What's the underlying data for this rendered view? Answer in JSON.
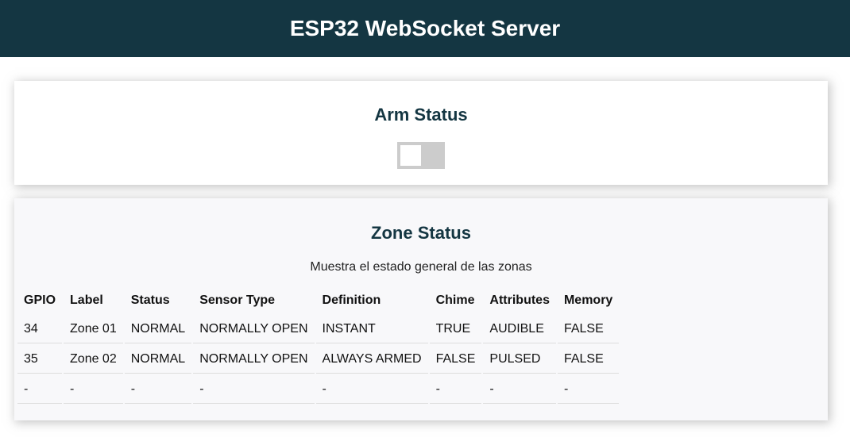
{
  "header": {
    "title": "ESP32 WebSocket Server"
  },
  "arm_card": {
    "title": "Arm Status",
    "toggle_state": "off"
  },
  "zone_card": {
    "title": "Zone Status",
    "subtitle": "Muestra el estado general de las zonas",
    "columns": [
      "GPIO",
      "Label",
      "Status",
      "Sensor Type",
      "Definition",
      "Chime",
      "Attributes",
      "Memory"
    ],
    "rows": [
      [
        "34",
        "Zone 01",
        "NORMAL",
        "NORMALLY OPEN",
        "INSTANT",
        "TRUE",
        "AUDIBLE",
        "FALSE"
      ],
      [
        "35",
        "Zone 02",
        "NORMAL",
        "NORMALLY OPEN",
        "ALWAYS ARMED",
        "FALSE",
        "PULSED",
        "FALSE"
      ],
      [
        "-",
        "-",
        "-",
        "-",
        "-",
        "-",
        "-",
        "-"
      ]
    ]
  },
  "colors": {
    "header_bg": "#143642",
    "title_text": "#143642",
    "toggle_bg": "#cccccc"
  }
}
